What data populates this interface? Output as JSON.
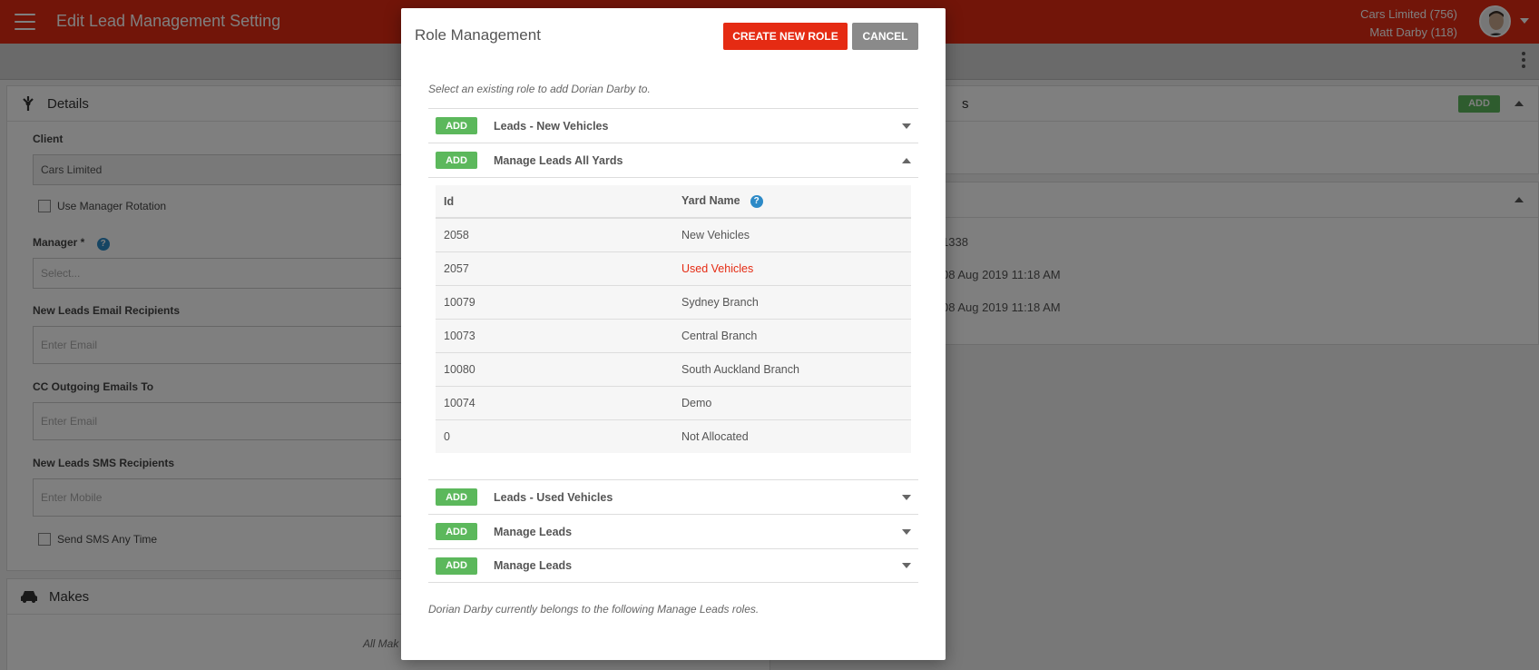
{
  "header": {
    "title": "Edit Lead Management Setting",
    "client_line": "Cars Limited (756)",
    "user_line": "Matt Darby (118)"
  },
  "details_card": {
    "title": "Details",
    "client_label": "Client",
    "client_value": "Cars Limited",
    "manager_rotation_label": "Use Manager Rotation",
    "manager_label": "Manager *",
    "manager_placeholder": "Select...",
    "email_recipients_label": "New Leads Email Recipients",
    "email_placeholder": "Enter Email",
    "cc_label": "CC Outgoing Emails To",
    "cc_placeholder": "Enter Email",
    "sms_label": "New Leads SMS Recipients",
    "sms_placeholder": "Enter Mobile",
    "sms_any_time_label": "Send SMS Any Time"
  },
  "makes_card": {
    "title": "Makes",
    "note_partial": "All Mak"
  },
  "right_panel": {
    "title_partial": "s",
    "add_label": "ADD",
    "info": [
      "1338",
      "08 Aug 2019 11:18 AM",
      "08 Aug 2019 11:18 AM"
    ]
  },
  "modal": {
    "title": "Role Management",
    "create_label": "CREATE NEW ROLE",
    "cancel_label": "CANCEL",
    "intro": "Select an existing role to add Dorian Darby to.",
    "footer": "Dorian Darby currently belongs to the following Manage Leads roles.",
    "add_label": "ADD",
    "roles": [
      {
        "name": "Leads - New Vehicles",
        "expanded": false
      },
      {
        "name": "Manage Leads All Yards",
        "expanded": true
      },
      {
        "name": "Leads - Used Vehicles",
        "expanded": false
      },
      {
        "name": "Manage Leads",
        "expanded": false
      },
      {
        "name": "Manage Leads",
        "expanded": false
      }
    ],
    "table": {
      "col_id": "Id",
      "col_yard": "Yard Name",
      "rows": [
        {
          "id": "2058",
          "yard": "New Vehicles"
        },
        {
          "id": "2057",
          "yard": "Used Vehicles"
        },
        {
          "id": "10079",
          "yard": "Sydney Branch"
        },
        {
          "id": "10073",
          "yard": "Central Branch"
        },
        {
          "id": "10080",
          "yard": "South Auckland Branch"
        },
        {
          "id": "10074",
          "yard": "Demo"
        },
        {
          "id": "0",
          "yard": "Not Allocated"
        }
      ]
    }
  },
  "colors": {
    "brand_red": "#e52b13",
    "add_green": "#5cb85c",
    "help_blue": "#2d8ac7"
  }
}
